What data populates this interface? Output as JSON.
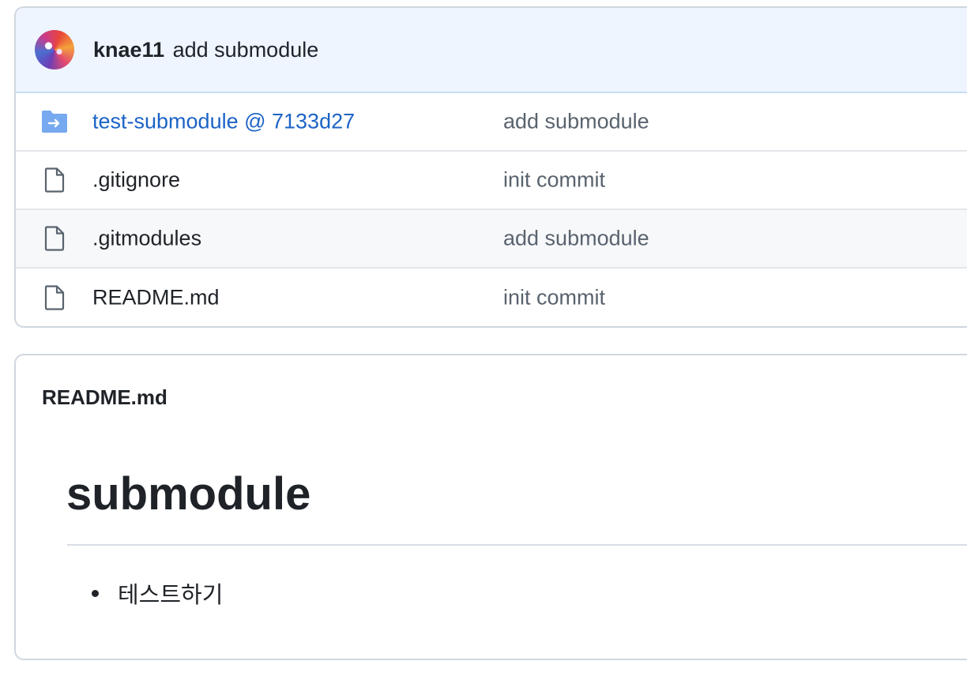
{
  "last_commit": {
    "author": "knae11",
    "message": "add submodule"
  },
  "files": [
    {
      "name": "test-submodule @ 7133d27",
      "commit": "add submodule",
      "icon": "submodule-folder-icon",
      "type": "submodule"
    },
    {
      "name": ".gitignore",
      "commit": "init commit",
      "icon": "file-icon",
      "type": "file"
    },
    {
      "name": ".gitmodules",
      "commit": "add submodule",
      "icon": "file-icon",
      "type": "file"
    },
    {
      "name": "README.md",
      "commit": "init commit",
      "icon": "file-icon",
      "type": "file"
    }
  ],
  "readme": {
    "filename": "README.md",
    "heading": "submodule",
    "items": [
      "테스트하기"
    ]
  },
  "colors": {
    "link": "#1c63c6",
    "submodule_icon": "#76a9ef",
    "header_bg": "#eef5ff",
    "border": "#d0d7de"
  }
}
